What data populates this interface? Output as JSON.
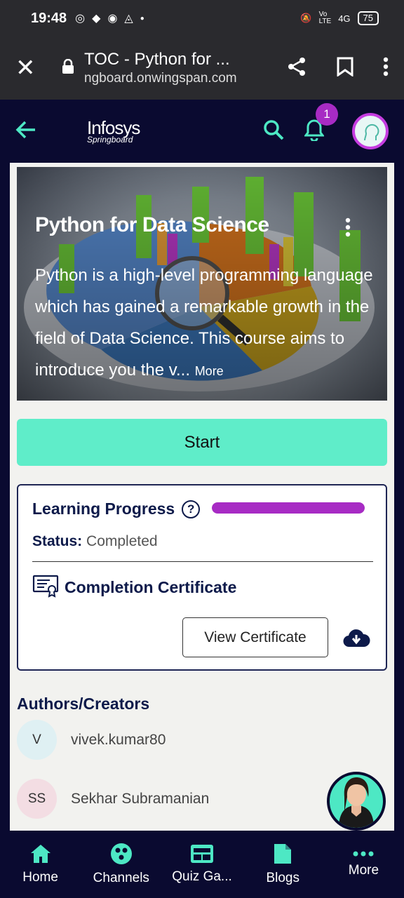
{
  "status_bar": {
    "time": "19:48",
    "battery": "75",
    "network": "4G"
  },
  "browser": {
    "page_title": "TOC - Python for ...",
    "url": "ngboard.onwingspan.com"
  },
  "header": {
    "logo_line1": "Infosys",
    "logo_line2": "Springboard",
    "notification_count": "1"
  },
  "course": {
    "title": "Python for Data Science",
    "description": "Python is a high-level programming language which has gained a remarkable growth in the field of Data Science. This course aims to introduce you the v...",
    "more_label": "More",
    "start_label": "Start"
  },
  "progress": {
    "title": "Learning Progress",
    "help": "?",
    "fraction": 1.0,
    "status_label": "Status:",
    "status_value": "Completed",
    "certificate_title": "Completion Certificate",
    "view_certificate_label": "View Certificate"
  },
  "authors": {
    "title": "Authors/Creators",
    "items": [
      {
        "initials": "V",
        "name": "vivek.kumar80",
        "color": "#dff0f3"
      },
      {
        "initials": "SS",
        "name": "Sekhar Subramanian",
        "color": "#f3dde3"
      }
    ]
  },
  "bottom_nav": [
    {
      "label": "Home",
      "icon": "home-icon"
    },
    {
      "label": "Channels",
      "icon": "channels-icon"
    },
    {
      "label": "Quiz Ga...",
      "icon": "quiz-icon"
    },
    {
      "label": "Blogs",
      "icon": "blog-icon"
    },
    {
      "label": "More",
      "icon": "more-icon"
    }
  ],
  "colors": {
    "accent": "#5fedc9",
    "brand_dark": "#0a0a30",
    "progress": "#a72bc4"
  }
}
